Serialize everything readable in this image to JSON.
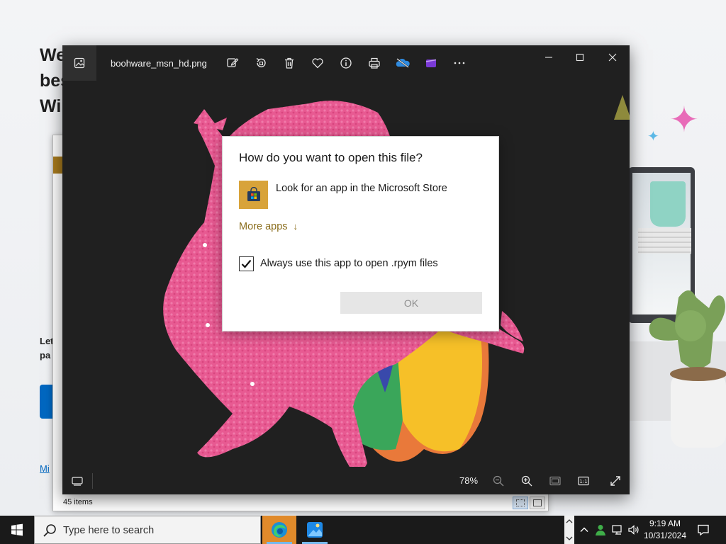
{
  "background_page": {
    "heading_lines": [
      "We",
      "bes",
      "Wi"
    ],
    "text_lines": [
      "Let",
      "pa"
    ],
    "link_text": "Mi"
  },
  "explorer": {
    "status_text": "45 items"
  },
  "photos_app": {
    "file_name": "boohware_msn_hd.png",
    "zoom_level": "78%",
    "toolbar_icons": [
      "edit-image-icon",
      "rotate-icon",
      "delete-icon",
      "favorite-icon",
      "info-icon",
      "print-icon",
      "onedrive-icon",
      "clipchamp-icon",
      "more-icon"
    ],
    "window_controls": [
      "minimize-icon",
      "maximize-icon",
      "close-icon"
    ]
  },
  "dialog": {
    "title": "How do you want to open this file?",
    "store_option": "Look for an app in the Microsoft Store",
    "more_apps": "More apps",
    "more_apps_arrow": "↓",
    "always_use_label": "Always use this app to open .rpym files",
    "always_use_checked": true,
    "ok_label": "OK"
  },
  "taskbar": {
    "search_placeholder": "Type here to search",
    "pinned_apps": [
      "edge-icon",
      "photos-icon"
    ],
    "clock_time": "9:19 AM",
    "clock_date": "10/31/2024"
  },
  "colors": {
    "dialog_link": "#8a6d1c",
    "store_tile": "#d8a33a",
    "viewer_bg": "#202020",
    "taskbar_bg": "#1a1a1a"
  }
}
